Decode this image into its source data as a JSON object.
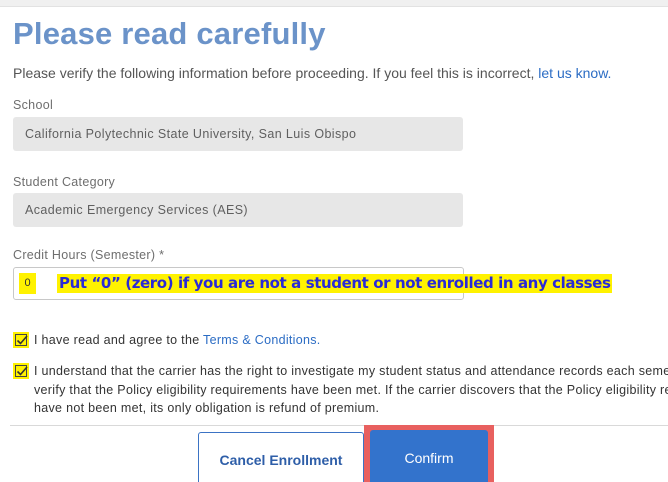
{
  "header": {
    "title": "Please read carefully"
  },
  "intro": {
    "text": "Please verify the following information before proceeding. If you feel this is incorrect,",
    "link_label": "let us know."
  },
  "school": {
    "label": "School",
    "value": "California Polytechnic State University, San Luis Obispo"
  },
  "student_category": {
    "label": "Student Category",
    "value": "Academic Emergency Services (AES)"
  },
  "credit_hours": {
    "label": "Credit Hours (Semester) *",
    "value": "0",
    "callout": "Put “0” (zero) if you are not a student or not enrolled in any classes"
  },
  "agreements": {
    "terms": {
      "text": "I have read and agree to the",
      "link_label": "Terms & Conditions.",
      "checked": true
    },
    "carrier": {
      "line1": "I understand that the carrier has the right to investigate my student status and attendance records each semester to",
      "line2": "verify that the Policy eligibility requirements have been met. If the carrier discovers that the Policy eligibility requirements",
      "line3": "have not been met, its only obligation is refund of premium.",
      "checked": true
    }
  },
  "actions": {
    "cancel_label": "Cancel Enrollment",
    "confirm_label": "Confirm"
  },
  "colors": {
    "title": "#6b93c9",
    "link": "#2b6cc4",
    "highlight": "#fff200",
    "callout_text": "#2a2ad6",
    "primary_button": "#3373cc",
    "focus_outline": "#e8605f"
  }
}
